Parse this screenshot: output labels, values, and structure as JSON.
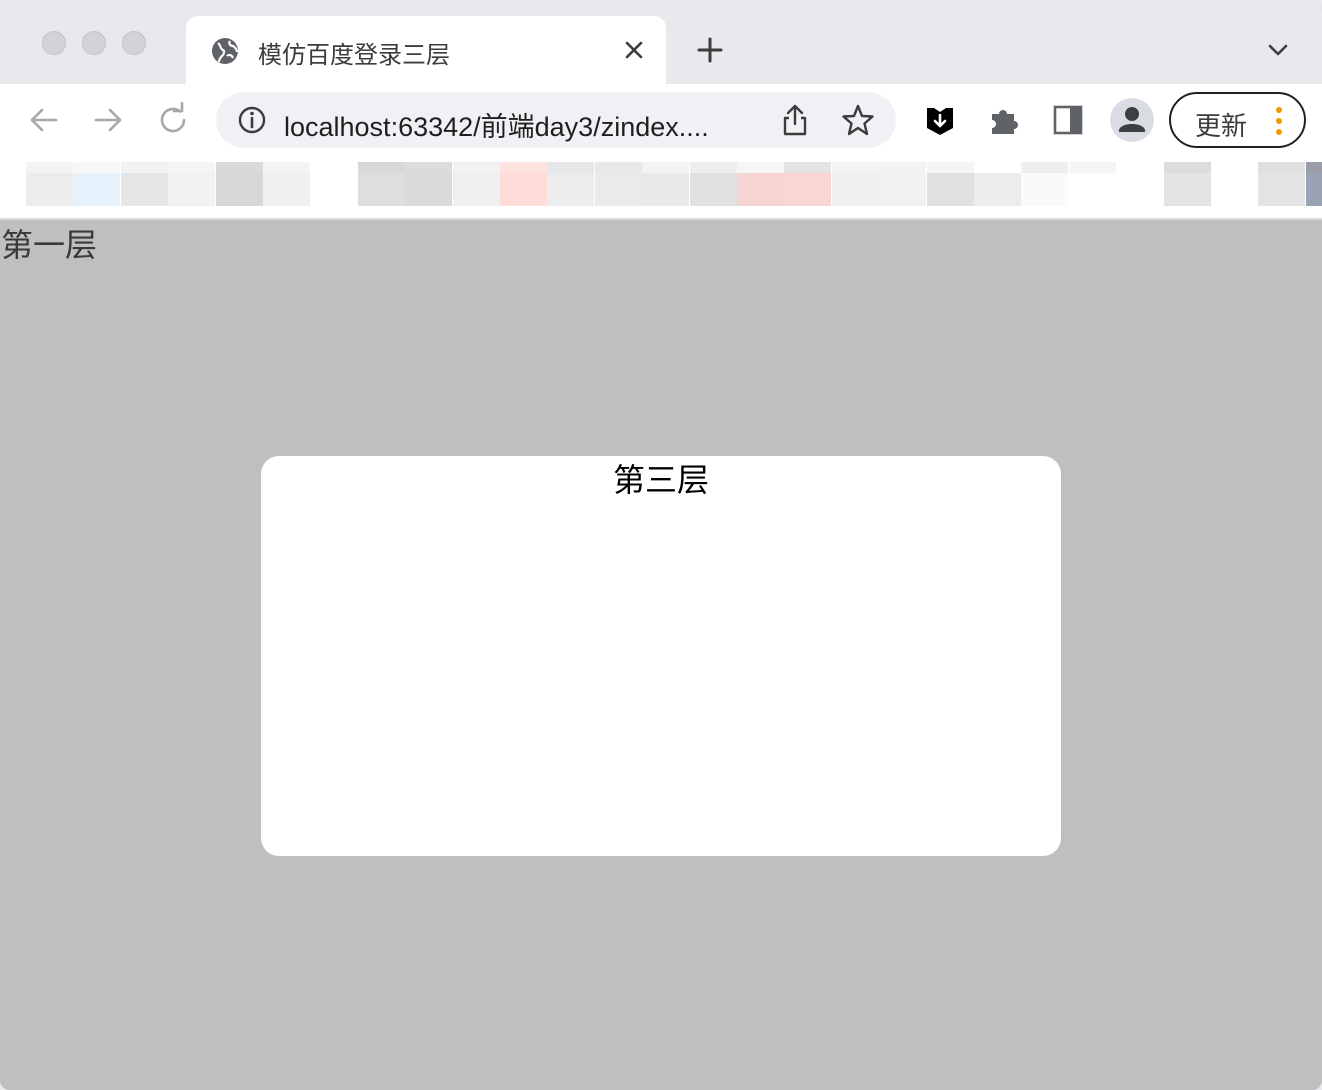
{
  "browser": {
    "tab": {
      "title": "模仿百度登录三层",
      "favicon": "globe-icon"
    },
    "omnibox": {
      "url": "localhost:63342/前端day3/zindex....",
      "info_icon": "info-icon"
    },
    "update_button_label": "更新",
    "colors": {
      "tabstrip_bg": "#e8e9ed",
      "toolbar_bg": "#ffffff",
      "omnibox_bg": "#f0f1f4",
      "menu_dots": "#f29900"
    }
  },
  "page": {
    "layer1_text": "第一层",
    "layer3_text": "第三层",
    "colors": {
      "background": "#bfbfbf",
      "layer3_bg": "#ffffff"
    }
  }
}
